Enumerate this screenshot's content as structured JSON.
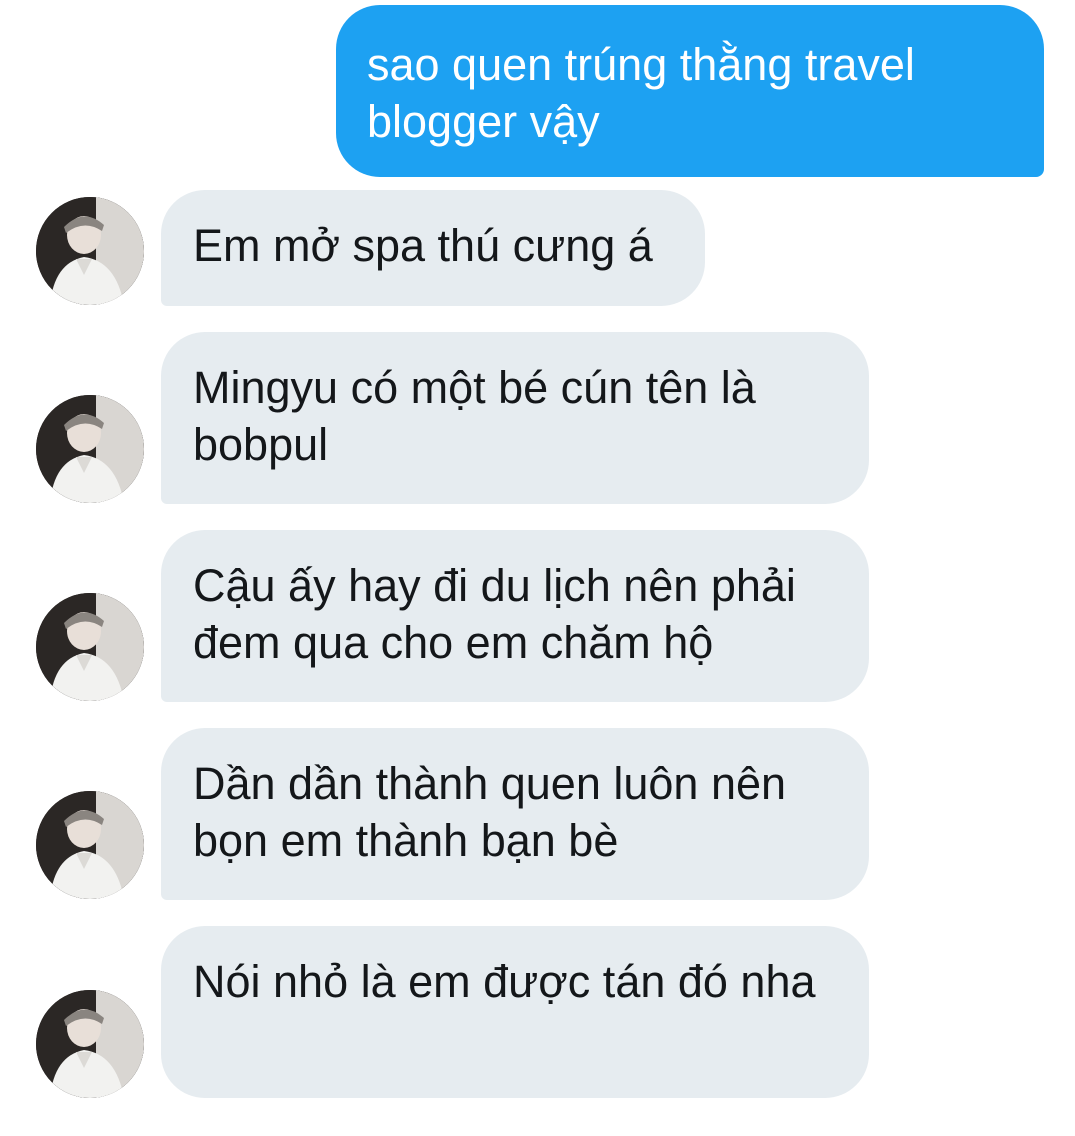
{
  "conversation": {
    "sent": [
      {
        "text": "sao quen trúng thằng travel blogger vậy"
      }
    ],
    "received": [
      {
        "text": "Em mở spa thú cưng á",
        "avatar": "avatar-photo"
      },
      {
        "text": "Mingyu có một bé cún tên là bobpul",
        "avatar": "avatar-photo"
      },
      {
        "text": "Cậu ấy hay đi du lịch nên phải đem qua cho em chăm hộ",
        "avatar": "avatar-photo"
      },
      {
        "text": "Dần dần thành quen luôn nên bọn em thành bạn bè",
        "avatar": "avatar-photo"
      },
      {
        "text": "Nói nhỏ là em được tán đó nha",
        "avatar": "avatar-photo"
      }
    ]
  },
  "colors": {
    "sent_bubble": "#1da1f2",
    "received_bubble": "#e6ecf0",
    "received_text": "#14171a",
    "sent_text": "#ffffff"
  }
}
